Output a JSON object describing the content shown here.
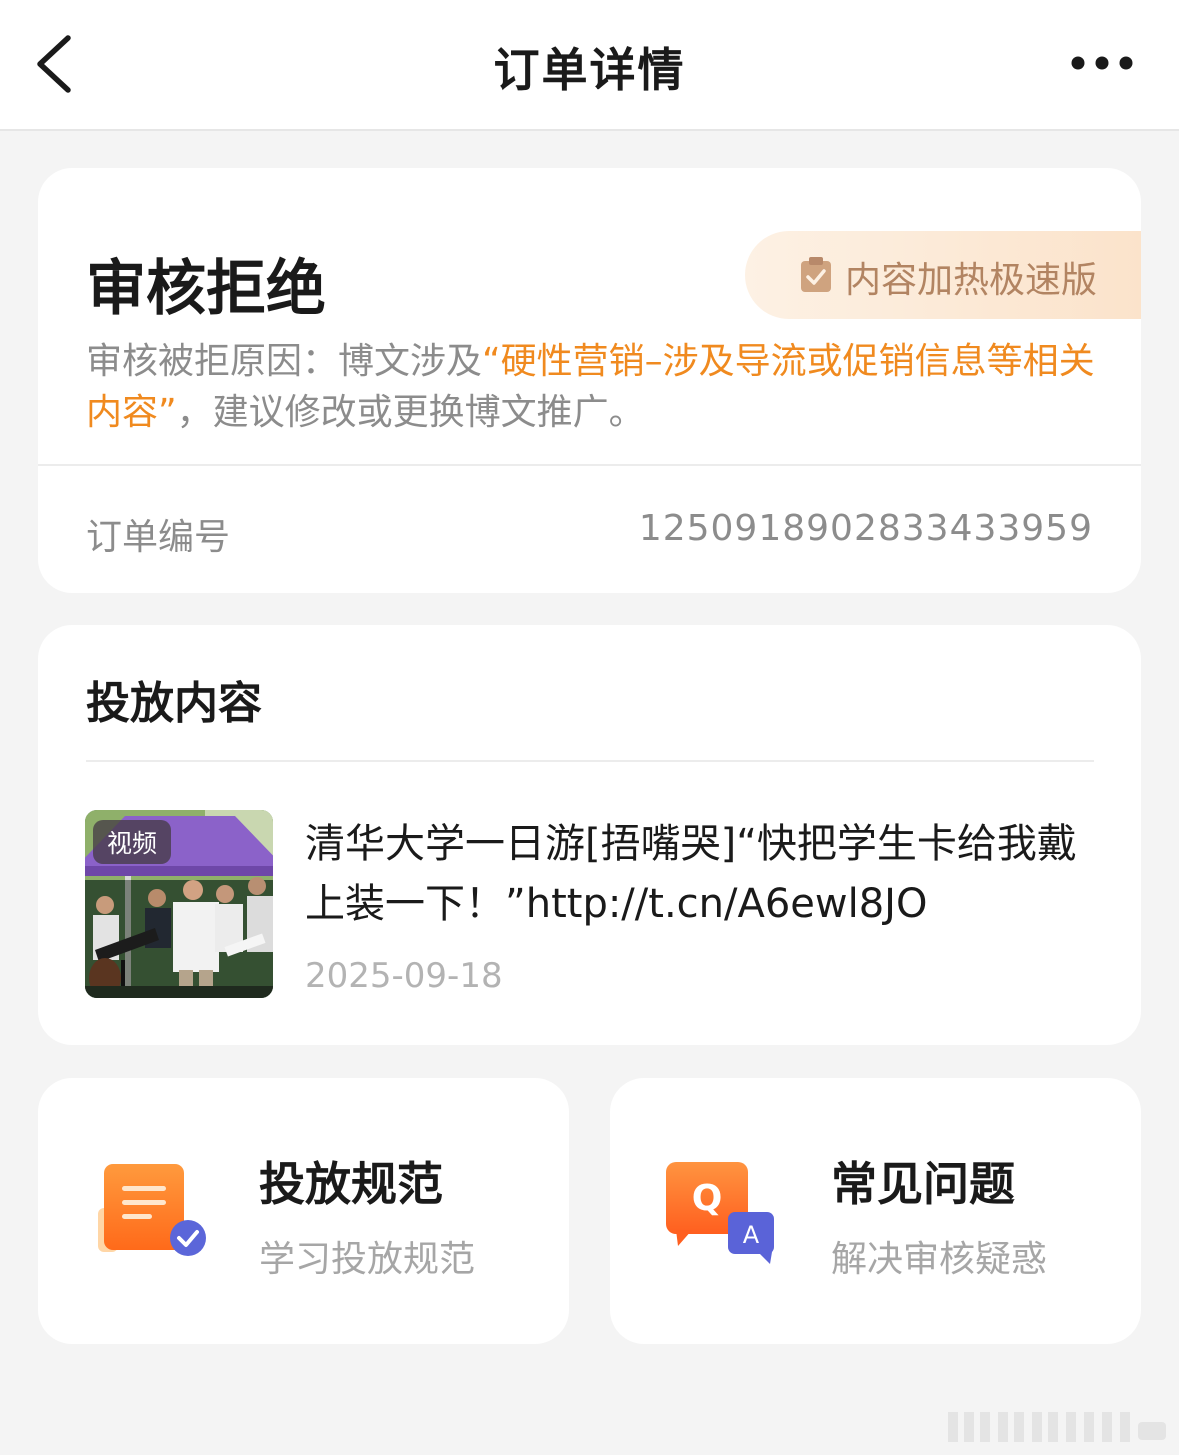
{
  "navbar": {
    "title": "订单详情"
  },
  "status_card": {
    "status": "审核拒绝",
    "product_tag": "内容加热极速版",
    "reason_prefix": "审核被拒原因：博文涉及",
    "reason_highlight": "“硬性营销–涉及导流或促销信息等相关内容”",
    "reason_suffix": "，建议修改或更换博文推广。",
    "order_label": "订单编号",
    "order_number": "1250918902833433959"
  },
  "content_card": {
    "title": "投放内容",
    "post": {
      "badge": "视频",
      "text": "清华大学一日游[捂嘴哭]“快把学生卡给我戴上装一下！”http://t.cn/A6ewl8JO",
      "date": "2025-09-18"
    }
  },
  "links": {
    "rules": {
      "title": "投放规范",
      "subtitle": "学习投放规范"
    },
    "faq": {
      "title": "常见问题",
      "subtitle": "解决审核疑惑"
    }
  },
  "colors": {
    "accent_orange": "#f08a1f",
    "tag_text": "#b28462",
    "faq_badge_blue": "#5a63d8"
  },
  "icons": {
    "back": "chevron-left-icon",
    "more": "more-dots-icon",
    "tag": "clipboard-check-icon",
    "rules": "document-check-icon",
    "faq": "qa-bubble-icon"
  }
}
